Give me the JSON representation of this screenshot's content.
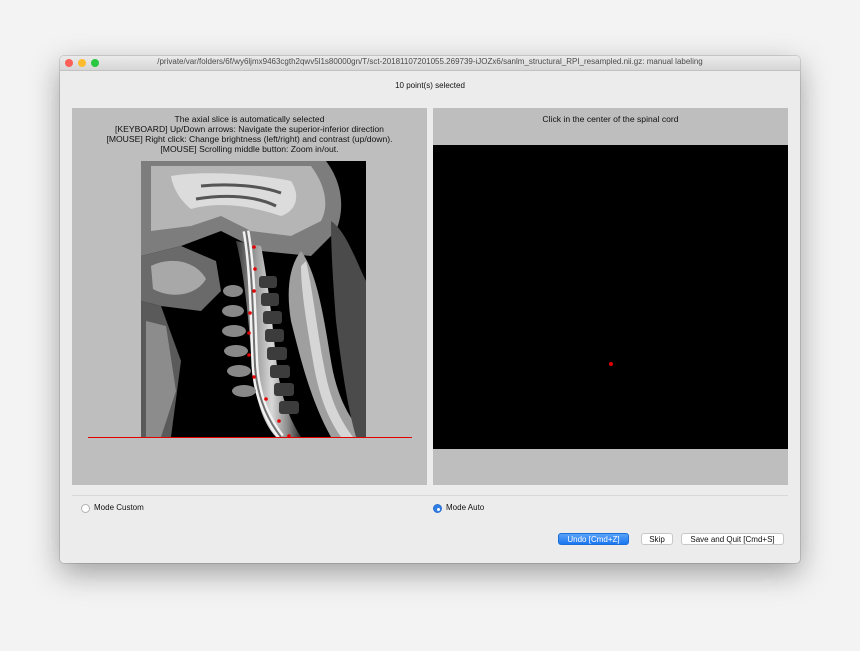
{
  "window": {
    "title": "/private/var/folders/6f/wy6ljmx9463cgth2qwv5l1s80000gn/T/sct-20181107201055.269739-iJOZx6/sanlm_structural_RPI_resampled.nii.gz: manual labeling"
  },
  "status": {
    "text": "10 point(s) selected"
  },
  "left_panel": {
    "instructions": [
      "The axial slice is automatically selected",
      "[KEYBOARD] Up/Down arrows: Navigate the superior-inferior direction",
      "[MOUSE] Right click: Change brightness (left/right) and contrast (up/down).",
      "[MOUSE] Scrolling middle button: Zoom in/out."
    ],
    "selected_point_count": 10
  },
  "right_panel": {
    "caption": "Click in the center of the spinal cord"
  },
  "modes": {
    "custom_label": "Mode Custom",
    "auto_label": "Mode Auto",
    "selected": "auto"
  },
  "buttons": {
    "undo": "Undo [Cmd+Z]",
    "skip": "Skip",
    "save_quit": "Save and Quit [Cmd+S]"
  },
  "colors": {
    "marker": "#e00000",
    "accent": "#1a77ef",
    "panel_bg": "#bebebe"
  }
}
